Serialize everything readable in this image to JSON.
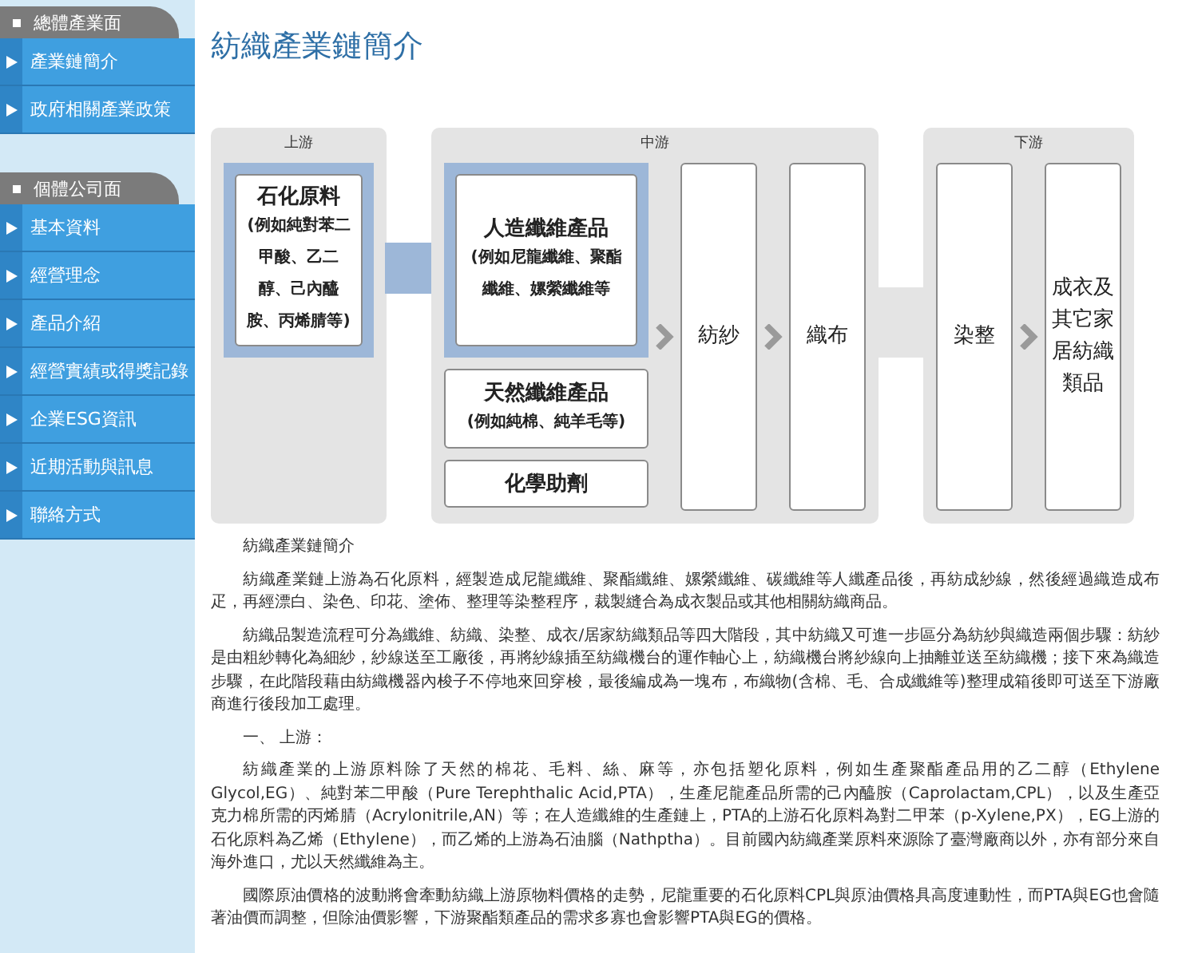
{
  "sidebar": {
    "sections": [
      {
        "title": "總體產業面",
        "items": [
          {
            "label": "產業鏈簡介"
          },
          {
            "label": "政府相關產業政策"
          }
        ]
      },
      {
        "title": "個體公司面",
        "items": [
          {
            "label": "基本資料"
          },
          {
            "label": "經營理念"
          },
          {
            "label": "產品介紹"
          },
          {
            "label": "經營實績或得獎記錄"
          },
          {
            "label": "企業ESG資訊"
          },
          {
            "label": "近期活動與訊息"
          },
          {
            "label": "聯絡方式"
          }
        ]
      }
    ]
  },
  "page_title": "紡織產業鏈簡介",
  "diagram": {
    "stages": [
      {
        "label": "上游",
        "link_highlighted": true,
        "columns": [
          {
            "kind": "stack",
            "boxes": [
              {
                "title": "石化原料",
                "note": "(例如純對苯二甲酸、乙二醇、己內醯胺、丙烯腈等)",
                "highlighted": true
              }
            ]
          }
        ]
      },
      {
        "label": "中游",
        "link_highlighted": false,
        "columns": [
          {
            "kind": "stack",
            "boxes": [
              {
                "title": "人造纖維產品",
                "note": "(例如尼龍纖維、聚酯纖維、嫘縈纖維等",
                "highlighted": true
              },
              {
                "title": "天然纖維產品",
                "note": "(例如純棉、純羊毛等)",
                "highlighted": false
              },
              {
                "title": "化學助劑",
                "highlighted": false
              }
            ]
          },
          {
            "kind": "tall",
            "text": "紡紗"
          },
          {
            "kind": "tall",
            "text": "織布"
          }
        ]
      },
      {
        "label": "下游",
        "columns": [
          {
            "kind": "tall",
            "text": "染整"
          },
          {
            "kind": "tall",
            "text": "成衣及其它家居紡織類品"
          }
        ]
      }
    ]
  },
  "article": [
    "紡織產業鏈簡介",
    "紡織產業鏈上游為石化原料，經製造成尼龍纖維、聚酯纖維、嫘縈纖維、碳纖維等人纖產品後，再紡成紗線，然後經過織造成布疋，再經漂白、染色、印花、塗佈、整理等染整程序，裁製縫合為成衣製品或其他相關紡織商品。",
    "紡織品製造流程可分為纖維、紡織、染整、成衣/居家紡織類品等四大階段，其中紡織又可進一步區分為紡紗與織造兩個步驟：紡紗是由粗紗轉化為細紗，紗線送至工廠後，再將紗線插至紡織機台的運作軸心上，紡織機台將紗線向上抽離並送至紡織機；接下來為織造步驟，在此階段藉由紡織機器內梭子不停地來回穿梭，最後編成為一塊布，布織物(含棉、毛、合成纖維等)整理成箱後即可送至下游廠商進行後段加工處理。",
    "一、 上游：",
    "紡織產業的上游原料除了天然的棉花、毛料、絲、麻等，亦包括塑化原料，例如生產聚酯產品用的乙二醇（Ethylene Glycol,EG）、純對苯二甲酸（Pure Terephthalic Acid,PTA），生產尼龍產品所需的己內醯胺（Caprolactam,CPL），以及生產亞克力棉所需的丙烯腈（Acrylonitrile,AN）等；在人造纖維的生產鏈上，PTA的上游石化原料為對二甲苯（p-Xylene,PX），EG上游的石化原料為乙烯（Ethylene），而乙烯的上游為石油腦（Nathptha）。目前國內紡織產業原料來源除了臺灣廠商以外，亦有部分來自海外進口，尤以天然纖維為主。",
    "國際原油價格的波動將會牽動紡織上游原物料價格的走勢，尼龍重要的石化原料CPL與原油價格具高度連動性，而PTA與EG也會隨著油價而調整，但除油價影響，下游聚酯類產品的需求多寡也會影響PTA與EG的價格。"
  ]
}
